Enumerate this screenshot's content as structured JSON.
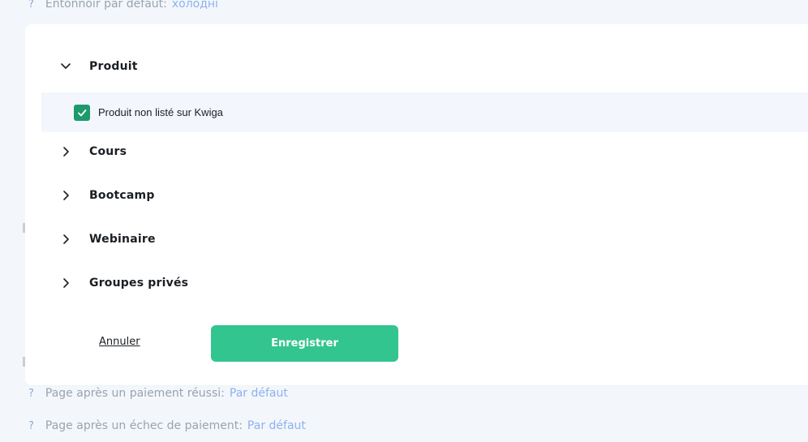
{
  "background": {
    "top_row": {
      "label": "Entonnoir par défaut:",
      "value": "холодні"
    },
    "rows": [
      {
        "label": "Page après un paiement réussi:",
        "value": "Par défaut"
      },
      {
        "label": "Page après un échec de paiement:",
        "value": "Par défaut"
      }
    ],
    "help_glyph": "?"
  },
  "modal": {
    "sections": [
      {
        "label": "Produit",
        "expanded": true,
        "icon": "chevron-down-icon"
      },
      {
        "label": "Cours",
        "expanded": false,
        "icon": "chevron-right-icon"
      },
      {
        "label": "Bootcamp",
        "expanded": false,
        "icon": "chevron-right-icon"
      },
      {
        "label": "Webinaire",
        "expanded": false,
        "icon": "chevron-right-icon"
      },
      {
        "label": "Groupes privés",
        "expanded": false,
        "icon": "chevron-right-icon"
      }
    ],
    "product_option": {
      "label": "Produit non listé sur Kwiga",
      "checked": true,
      "icon": "checkmark-icon"
    },
    "cancel_label": "Annuler",
    "save_label": "Enregistrer"
  },
  "colors": {
    "accent": "#33c58f",
    "checkbox": "#1d9a6c",
    "link_value": "#8fb0ef"
  }
}
